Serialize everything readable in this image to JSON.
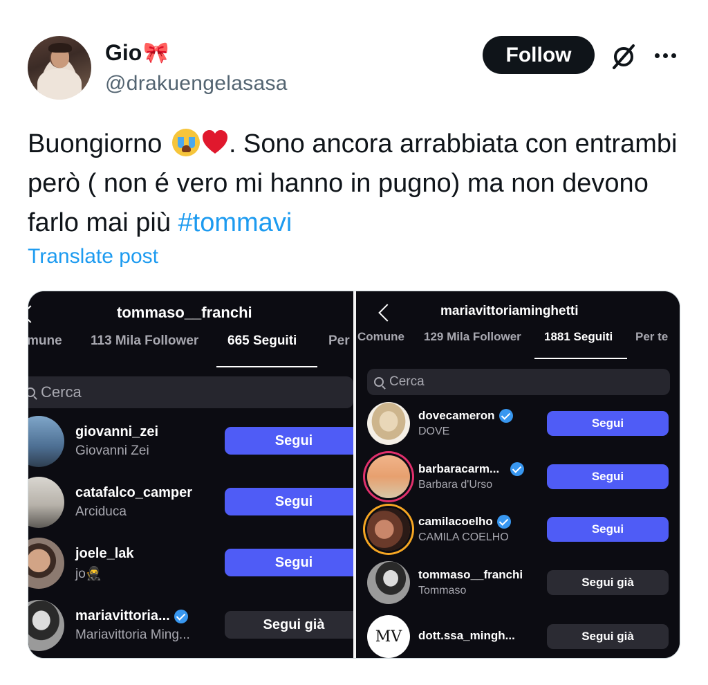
{
  "tweet": {
    "display_name": "Gio",
    "name_emoji": "🎀",
    "handle": "@drakuengelasasa",
    "follow_label": "Follow",
    "text_part1": "Buongiorno ",
    "text_part2": ". Sono ancora arrabbiata con entrambi però ( non é vero mi hanno in pugno) ma non devono farlo mai più ",
    "hashtag": "#tommavi",
    "translate_label": "Translate post",
    "emojis": [
      "loudly-crying-face",
      "red-heart"
    ],
    "colors": {
      "link": "#1d9bf0",
      "text": "#0f1419",
      "secondary": "#536471",
      "follow_bg": "#0f1419"
    }
  },
  "media": {
    "left": {
      "title": "tommaso__franchi",
      "tabs": [
        "mune",
        "113 Mila Follower",
        "665 Seguiti",
        "Per"
      ],
      "active_tab_index": 2,
      "search_placeholder": "Cerca",
      "rows": [
        {
          "username": "giovanni_zei",
          "subtitle": "Giovanni Zei",
          "verified": false,
          "button": "Segui"
        },
        {
          "username": "catafalco_camper",
          "subtitle": "Arciduca",
          "verified": false,
          "button": "Segui"
        },
        {
          "username": "joele_lak",
          "subtitle": "jo🥷",
          "verified": false,
          "button": "Segui"
        },
        {
          "username": "mariavittoria...",
          "subtitle": "Mariavittoria Ming...",
          "verified": true,
          "button": "Segui già"
        }
      ]
    },
    "right": {
      "title": "mariavittoriaminghetti",
      "tabs": [
        "Comune",
        "129 Mila Follower",
        "1881 Seguiti",
        "Per te"
      ],
      "active_tab_index": 2,
      "search_placeholder": "Cerca",
      "rows": [
        {
          "username": "dovecameron",
          "subtitle": "DOVE",
          "verified": true,
          "button": "Segui"
        },
        {
          "username": "barbaracarm...",
          "subtitle": "Barbara d'Urso",
          "verified": true,
          "button": "Segui"
        },
        {
          "username": "camilacoelho",
          "subtitle": "CAMILA COELHO",
          "verified": true,
          "button": "Segui"
        },
        {
          "username": "tommaso__franchi",
          "subtitle": "Tommaso",
          "verified": false,
          "button": "Segui già"
        },
        {
          "username": "dott.ssa_mingh...",
          "subtitle": "",
          "verified": false,
          "button": "Segui già",
          "avatar_text": "MV"
        }
      ]
    },
    "colors": {
      "follow_button": "#4f5cf6",
      "following_button": "#2b2b33",
      "background": "#0c0c12"
    }
  }
}
